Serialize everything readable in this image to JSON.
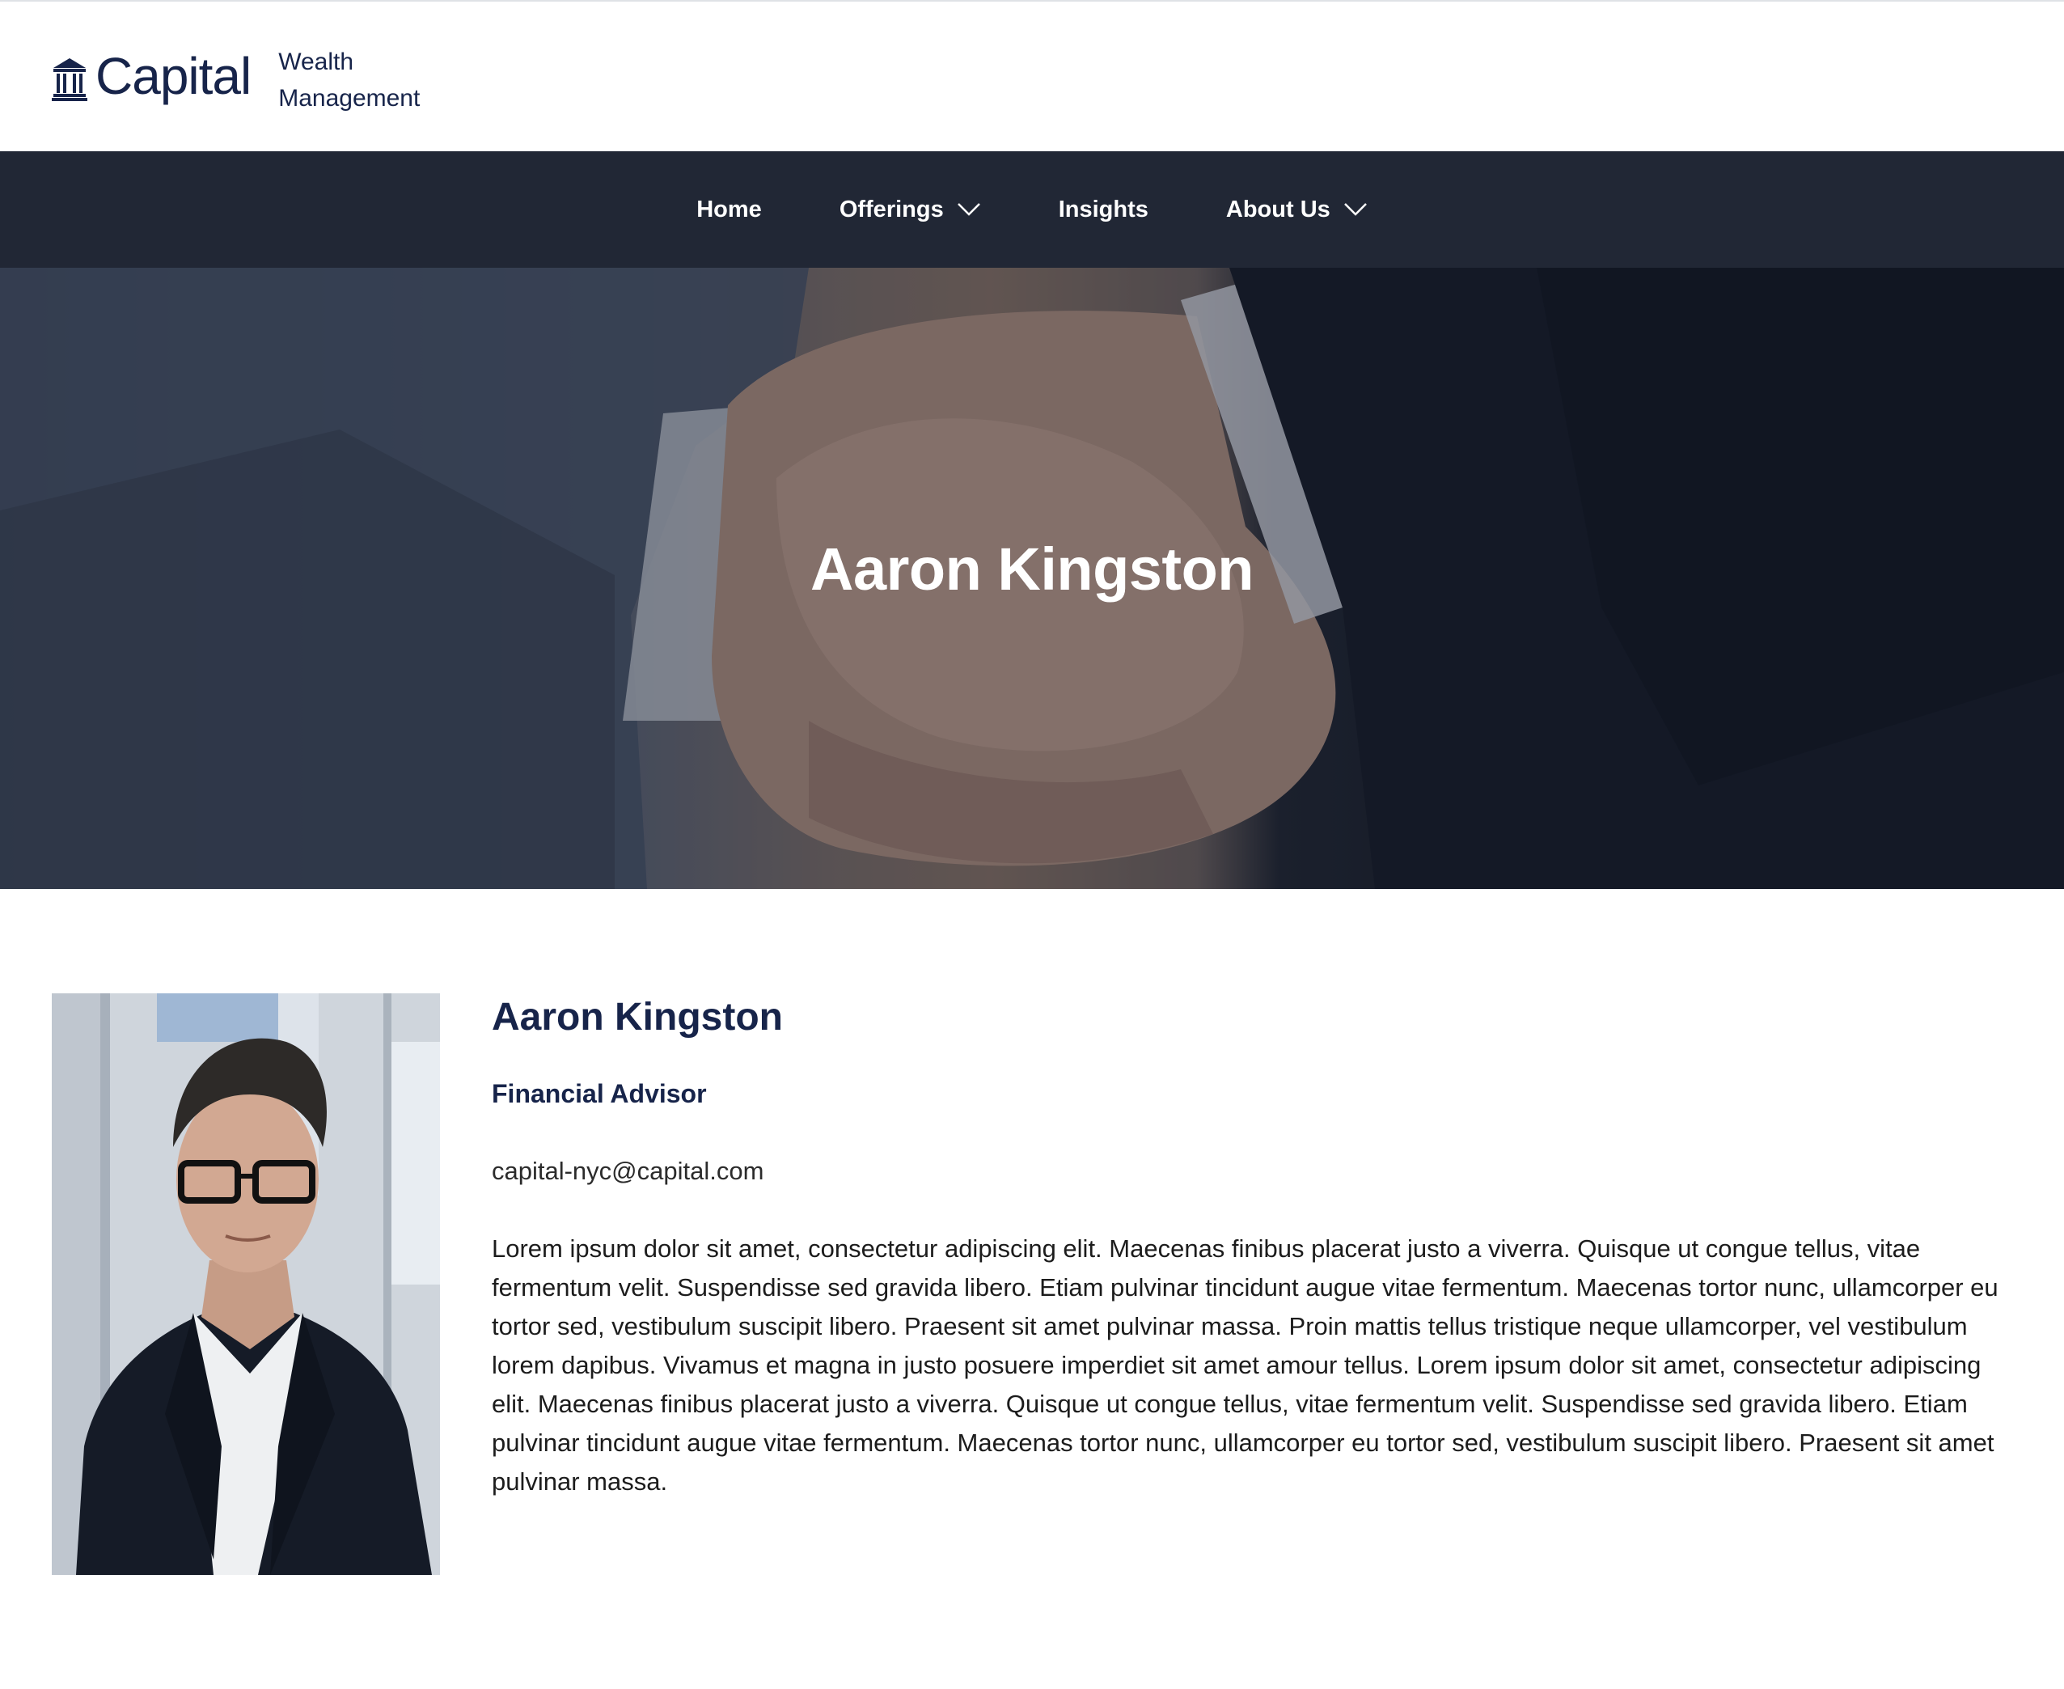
{
  "brand": {
    "name": "Capital",
    "tagline_line1": "Wealth",
    "tagline_line2": "Management",
    "color": "#17244a"
  },
  "nav": {
    "items": [
      {
        "label": "Home",
        "has_dropdown": false
      },
      {
        "label": "Offerings",
        "has_dropdown": true
      },
      {
        "label": "Insights",
        "has_dropdown": false
      },
      {
        "label": "About Us",
        "has_dropdown": true
      }
    ],
    "background": "#212735"
  },
  "hero": {
    "title": "Aaron Kingston",
    "image": "handshake-photo"
  },
  "profile": {
    "photo": "advisor-portrait",
    "name": "Aaron Kingston",
    "role": "Financial Advisor",
    "email": "capital-nyc@capital.com",
    "bio": "Lorem ipsum dolor sit amet, consectetur adipiscing elit. Maecenas finibus placerat justo a viverra. Quisque ut congue tellus, vitae fermentum velit. Suspendisse sed gravida libero. Etiam pulvinar tincidunt augue vitae fermentum. Maecenas tortor nunc, ullamcorper eu tortor sed, vestibulum suscipit libero. Praesent sit amet pulvinar massa. Proin mattis tellus tristique neque ullamcorper, vel vestibulum lorem dapibus. Vivamus et magna in justo posuere imperdiet sit amet amour tellus. Lorem ipsum dolor sit amet, consectetur adipiscing elit. Maecenas finibus placerat justo a viverra. Quisque ut congue tellus, vitae fermentum velit. Suspendisse sed gravida libero. Etiam pulvinar tincidunt augue vitae fermentum. Maecenas tortor nunc, ullamcorper eu tortor sed, vestibulum suscipit libero. Praesent sit amet pulvinar massa."
  }
}
